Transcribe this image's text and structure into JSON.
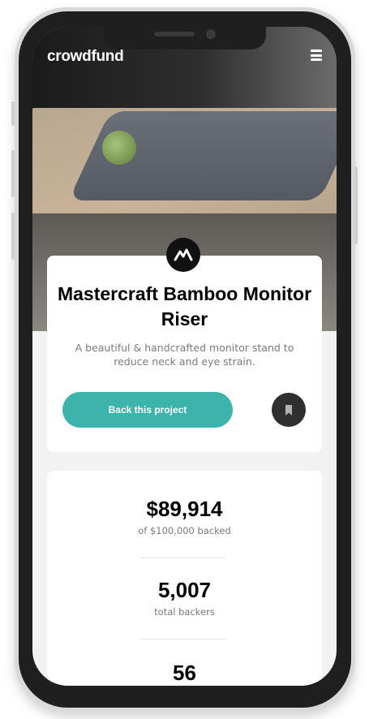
{
  "header": {
    "logo_text": "crowdfund",
    "menu_icon": "hamburger-icon"
  },
  "project": {
    "title": "Mastercraft Bamboo Monitor Riser",
    "description": "A beautiful & handcrafted monitor stand to reduce neck and eye strain.",
    "back_button_label": "Back this project",
    "bookmark_icon": "bookmark-icon",
    "brand_icon": "mastercraft-logo-icon"
  },
  "stats": [
    {
      "value": "$89,914",
      "label": "of $100,000 backed"
    },
    {
      "value": "5,007",
      "label": "total backers"
    },
    {
      "value": "56",
      "label": ""
    }
  ],
  "colors": {
    "accent": "#3cb3ab",
    "dark": "#2f2f2f",
    "text_muted": "#7a7a7a"
  }
}
